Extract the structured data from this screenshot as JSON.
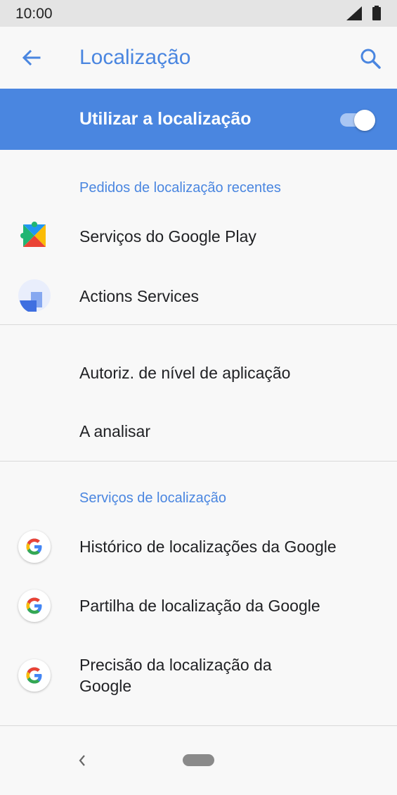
{
  "status_bar": {
    "time": "10:00",
    "icons": [
      "signal-icon",
      "battery-icon"
    ]
  },
  "app_bar": {
    "title": "Localização",
    "back_icon": "arrow-back-icon",
    "search_icon": "search-icon"
  },
  "master_switch": {
    "label": "Utilizar a localização",
    "checked": true,
    "color": "#4a86e0"
  },
  "recent_requests": {
    "header": "Pedidos de localização recentes",
    "items": [
      {
        "label": "Serviços do Google Play",
        "icon": "google-play-services-icon"
      },
      {
        "label": "Actions Services",
        "icon": "actions-services-icon"
      }
    ]
  },
  "settings_items": [
    {
      "label": "Autoriz. de nível de aplicação"
    },
    {
      "label": "A analisar"
    }
  ],
  "location_services": {
    "header": "Serviços de localização",
    "items": [
      {
        "label": "Histórico de localizações da Google",
        "icon": "google-g-icon"
      },
      {
        "label": "Partilha de localização da Google",
        "icon": "google-g-icon"
      },
      {
        "label_line1": "Precisão da localização da",
        "label_line2": "Google",
        "icon": "google-g-icon"
      }
    ]
  },
  "nav_bar": {
    "back_icon": "nav-back-icon",
    "home_icon": "nav-home-pill-icon"
  },
  "colors": {
    "accent": "#4a86e0",
    "background": "#f8f8f8",
    "status_bar": "#e4e4e4"
  }
}
